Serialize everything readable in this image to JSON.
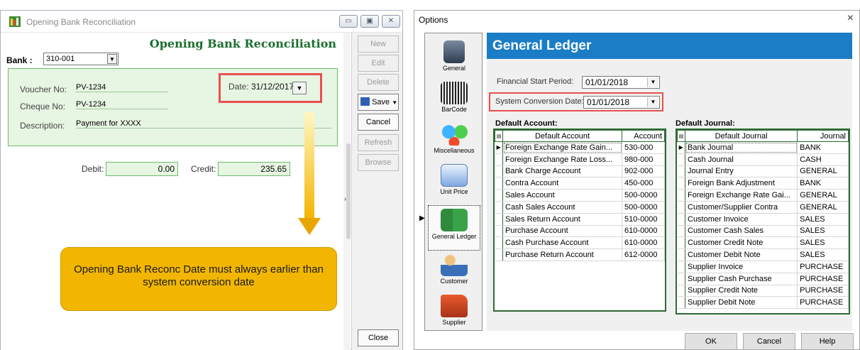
{
  "left_window": {
    "title": "Opening Bank Reconciliation",
    "heading": "Opening Bank Reconciliation",
    "bank_label": "Bank :",
    "bank_value": "310-001",
    "voucher_label": "Voucher No:",
    "voucher_value": "PV-1234",
    "cheque_label": "Cheque No:",
    "cheque_value": "PV-1234",
    "description_label": "Description:",
    "description_value": "Payment for XXXX",
    "date_label": "Date:",
    "date_value": "31/12/2017",
    "debit_label": "Debit:",
    "debit_value": "0.00",
    "credit_label": "Credit:",
    "credit_value": "235.65",
    "buttons": {
      "new": "New",
      "edit": "Edit",
      "delete": "Delete",
      "save": "Save",
      "cancel": "Cancel",
      "refresh": "Refresh",
      "browse": "Browse",
      "close": "Close"
    },
    "callout": "Opening Bank Reconc Date must always earlier than system conversion date"
  },
  "options_dialog": {
    "title": "Options",
    "close_glyph": "×",
    "nav": [
      {
        "label": "General",
        "icon": "building-icon"
      },
      {
        "label": "BarCode",
        "icon": "barcode-scanner-icon"
      },
      {
        "label": "Miscellaneous",
        "icon": "misc-spheres-icon"
      },
      {
        "label": "Unit Price",
        "icon": "price-list-icon"
      },
      {
        "label": "General Ledger",
        "icon": "ledger-books-icon"
      },
      {
        "label": "Customer",
        "icon": "customer-icon"
      },
      {
        "label": "Supplier",
        "icon": "supplier-truck-icon"
      }
    ],
    "banner": "General Ledger",
    "financial_start_label": "Financial Start Period:",
    "financial_start_value": "01/01/2018",
    "conversion_label": "System Conversion Date:",
    "conversion_value": "01/01/2018",
    "default_account": {
      "title": "Default Account:",
      "headers": [
        "Default Account",
        "Account"
      ],
      "rows": [
        [
          "Foreign Exchange Rate Gain...",
          "530-000"
        ],
        [
          "Foreign Exchange Rate Loss...",
          "980-000"
        ],
        [
          "Bank Charge Account",
          "902-000"
        ],
        [
          "Contra Account",
          "450-000"
        ],
        [
          "Sales Account",
          "500-0000"
        ],
        [
          "Cash Sales Account",
          "500-0000"
        ],
        [
          "Sales Return Account",
          "510-0000"
        ],
        [
          "Purchase Account",
          "610-0000"
        ],
        [
          "Cash Purchase Account",
          "610-0000"
        ],
        [
          "Purchase Return Account",
          "612-0000"
        ]
      ]
    },
    "default_journal": {
      "title": "Default Journal:",
      "headers": [
        "Default Journal",
        "Journal"
      ],
      "rows": [
        [
          "Bank Journal",
          "BANK"
        ],
        [
          "Cash Journal",
          "CASH"
        ],
        [
          "Journal Entry",
          "GENERAL"
        ],
        [
          "Foreign Bank Adjustment",
          "BANK"
        ],
        [
          "Foreign Exchange Rate Gai...",
          "GENERAL"
        ],
        [
          "Customer/Supplier Contra",
          "GENERAL"
        ],
        [
          "Customer Invoice",
          "SALES"
        ],
        [
          "Customer Cash Sales",
          "SALES"
        ],
        [
          "Customer Credit Note",
          "SALES"
        ],
        [
          "Customer Debit Note",
          "SALES"
        ],
        [
          "Supplier Invoice",
          "PURCHASE"
        ],
        [
          "Supplier Cash Purchase",
          "PURCHASE"
        ],
        [
          "Supplier Credit Note",
          "PURCHASE"
        ],
        [
          "Supplier Debit Note",
          "PURCHASE"
        ]
      ]
    },
    "buttons": {
      "ok": "OK",
      "cancel": "Cancel",
      "help": "Help"
    }
  }
}
